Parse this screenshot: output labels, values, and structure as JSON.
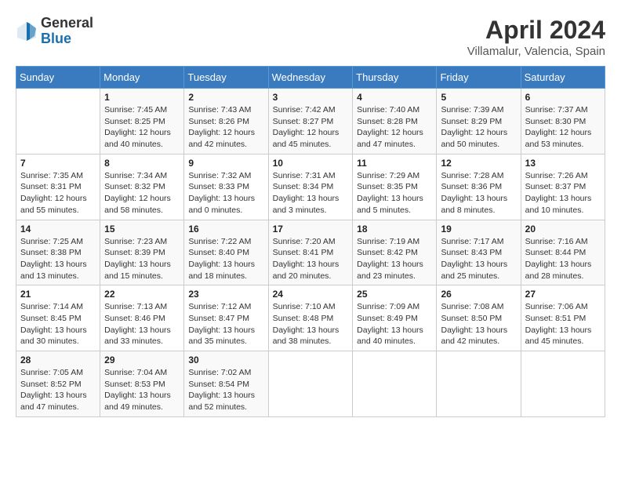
{
  "header": {
    "logo_line1": "General",
    "logo_line2": "Blue",
    "month_title": "April 2024",
    "location": "Villamalur, Valencia, Spain"
  },
  "calendar": {
    "days_of_week": [
      "Sunday",
      "Monday",
      "Tuesday",
      "Wednesday",
      "Thursday",
      "Friday",
      "Saturday"
    ],
    "weeks": [
      [
        {
          "day": "",
          "info": ""
        },
        {
          "day": "1",
          "info": "Sunrise: 7:45 AM\nSunset: 8:25 PM\nDaylight: 12 hours\nand 40 minutes."
        },
        {
          "day": "2",
          "info": "Sunrise: 7:43 AM\nSunset: 8:26 PM\nDaylight: 12 hours\nand 42 minutes."
        },
        {
          "day": "3",
          "info": "Sunrise: 7:42 AM\nSunset: 8:27 PM\nDaylight: 12 hours\nand 45 minutes."
        },
        {
          "day": "4",
          "info": "Sunrise: 7:40 AM\nSunset: 8:28 PM\nDaylight: 12 hours\nand 47 minutes."
        },
        {
          "day": "5",
          "info": "Sunrise: 7:39 AM\nSunset: 8:29 PM\nDaylight: 12 hours\nand 50 minutes."
        },
        {
          "day": "6",
          "info": "Sunrise: 7:37 AM\nSunset: 8:30 PM\nDaylight: 12 hours\nand 53 minutes."
        }
      ],
      [
        {
          "day": "7",
          "info": "Sunrise: 7:35 AM\nSunset: 8:31 PM\nDaylight: 12 hours\nand 55 minutes."
        },
        {
          "day": "8",
          "info": "Sunrise: 7:34 AM\nSunset: 8:32 PM\nDaylight: 12 hours\nand 58 minutes."
        },
        {
          "day": "9",
          "info": "Sunrise: 7:32 AM\nSunset: 8:33 PM\nDaylight: 13 hours\nand 0 minutes."
        },
        {
          "day": "10",
          "info": "Sunrise: 7:31 AM\nSunset: 8:34 PM\nDaylight: 13 hours\nand 3 minutes."
        },
        {
          "day": "11",
          "info": "Sunrise: 7:29 AM\nSunset: 8:35 PM\nDaylight: 13 hours\nand 5 minutes."
        },
        {
          "day": "12",
          "info": "Sunrise: 7:28 AM\nSunset: 8:36 PM\nDaylight: 13 hours\nand 8 minutes."
        },
        {
          "day": "13",
          "info": "Sunrise: 7:26 AM\nSunset: 8:37 PM\nDaylight: 13 hours\nand 10 minutes."
        }
      ],
      [
        {
          "day": "14",
          "info": "Sunrise: 7:25 AM\nSunset: 8:38 PM\nDaylight: 13 hours\nand 13 minutes."
        },
        {
          "day": "15",
          "info": "Sunrise: 7:23 AM\nSunset: 8:39 PM\nDaylight: 13 hours\nand 15 minutes."
        },
        {
          "day": "16",
          "info": "Sunrise: 7:22 AM\nSunset: 8:40 PM\nDaylight: 13 hours\nand 18 minutes."
        },
        {
          "day": "17",
          "info": "Sunrise: 7:20 AM\nSunset: 8:41 PM\nDaylight: 13 hours\nand 20 minutes."
        },
        {
          "day": "18",
          "info": "Sunrise: 7:19 AM\nSunset: 8:42 PM\nDaylight: 13 hours\nand 23 minutes."
        },
        {
          "day": "19",
          "info": "Sunrise: 7:17 AM\nSunset: 8:43 PM\nDaylight: 13 hours\nand 25 minutes."
        },
        {
          "day": "20",
          "info": "Sunrise: 7:16 AM\nSunset: 8:44 PM\nDaylight: 13 hours\nand 28 minutes."
        }
      ],
      [
        {
          "day": "21",
          "info": "Sunrise: 7:14 AM\nSunset: 8:45 PM\nDaylight: 13 hours\nand 30 minutes."
        },
        {
          "day": "22",
          "info": "Sunrise: 7:13 AM\nSunset: 8:46 PM\nDaylight: 13 hours\nand 33 minutes."
        },
        {
          "day": "23",
          "info": "Sunrise: 7:12 AM\nSunset: 8:47 PM\nDaylight: 13 hours\nand 35 minutes."
        },
        {
          "day": "24",
          "info": "Sunrise: 7:10 AM\nSunset: 8:48 PM\nDaylight: 13 hours\nand 38 minutes."
        },
        {
          "day": "25",
          "info": "Sunrise: 7:09 AM\nSunset: 8:49 PM\nDaylight: 13 hours\nand 40 minutes."
        },
        {
          "day": "26",
          "info": "Sunrise: 7:08 AM\nSunset: 8:50 PM\nDaylight: 13 hours\nand 42 minutes."
        },
        {
          "day": "27",
          "info": "Sunrise: 7:06 AM\nSunset: 8:51 PM\nDaylight: 13 hours\nand 45 minutes."
        }
      ],
      [
        {
          "day": "28",
          "info": "Sunrise: 7:05 AM\nSunset: 8:52 PM\nDaylight: 13 hours\nand 47 minutes."
        },
        {
          "day": "29",
          "info": "Sunrise: 7:04 AM\nSunset: 8:53 PM\nDaylight: 13 hours\nand 49 minutes."
        },
        {
          "day": "30",
          "info": "Sunrise: 7:02 AM\nSunset: 8:54 PM\nDaylight: 13 hours\nand 52 minutes."
        },
        {
          "day": "",
          "info": ""
        },
        {
          "day": "",
          "info": ""
        },
        {
          "day": "",
          "info": ""
        },
        {
          "day": "",
          "info": ""
        }
      ]
    ]
  }
}
